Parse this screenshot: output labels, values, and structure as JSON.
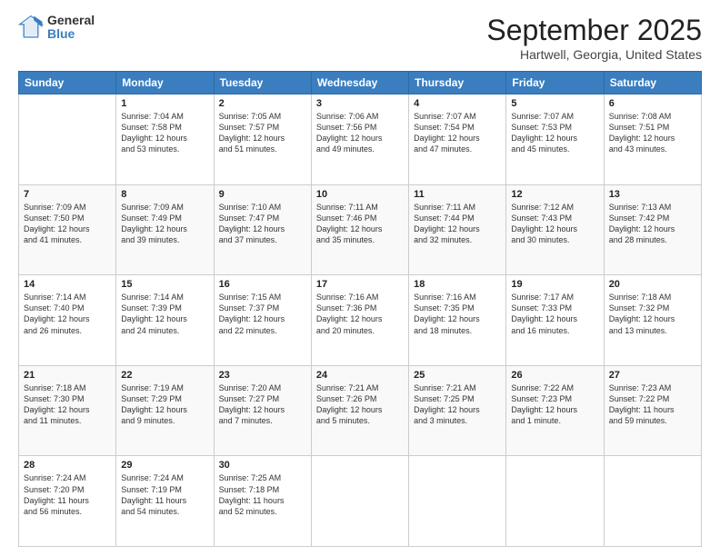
{
  "logo": {
    "general": "General",
    "blue": "Blue"
  },
  "title": {
    "month": "September 2025",
    "location": "Hartwell, Georgia, United States"
  },
  "header_days": [
    "Sunday",
    "Monday",
    "Tuesday",
    "Wednesday",
    "Thursday",
    "Friday",
    "Saturday"
  ],
  "weeks": [
    [
      {
        "day": "",
        "info": ""
      },
      {
        "day": "1",
        "info": "Sunrise: 7:04 AM\nSunset: 7:58 PM\nDaylight: 12 hours\nand 53 minutes."
      },
      {
        "day": "2",
        "info": "Sunrise: 7:05 AM\nSunset: 7:57 PM\nDaylight: 12 hours\nand 51 minutes."
      },
      {
        "day": "3",
        "info": "Sunrise: 7:06 AM\nSunset: 7:56 PM\nDaylight: 12 hours\nand 49 minutes."
      },
      {
        "day": "4",
        "info": "Sunrise: 7:07 AM\nSunset: 7:54 PM\nDaylight: 12 hours\nand 47 minutes."
      },
      {
        "day": "5",
        "info": "Sunrise: 7:07 AM\nSunset: 7:53 PM\nDaylight: 12 hours\nand 45 minutes."
      },
      {
        "day": "6",
        "info": "Sunrise: 7:08 AM\nSunset: 7:51 PM\nDaylight: 12 hours\nand 43 minutes."
      }
    ],
    [
      {
        "day": "7",
        "info": "Sunrise: 7:09 AM\nSunset: 7:50 PM\nDaylight: 12 hours\nand 41 minutes."
      },
      {
        "day": "8",
        "info": "Sunrise: 7:09 AM\nSunset: 7:49 PM\nDaylight: 12 hours\nand 39 minutes."
      },
      {
        "day": "9",
        "info": "Sunrise: 7:10 AM\nSunset: 7:47 PM\nDaylight: 12 hours\nand 37 minutes."
      },
      {
        "day": "10",
        "info": "Sunrise: 7:11 AM\nSunset: 7:46 PM\nDaylight: 12 hours\nand 35 minutes."
      },
      {
        "day": "11",
        "info": "Sunrise: 7:11 AM\nSunset: 7:44 PM\nDaylight: 12 hours\nand 32 minutes."
      },
      {
        "day": "12",
        "info": "Sunrise: 7:12 AM\nSunset: 7:43 PM\nDaylight: 12 hours\nand 30 minutes."
      },
      {
        "day": "13",
        "info": "Sunrise: 7:13 AM\nSunset: 7:42 PM\nDaylight: 12 hours\nand 28 minutes."
      }
    ],
    [
      {
        "day": "14",
        "info": "Sunrise: 7:14 AM\nSunset: 7:40 PM\nDaylight: 12 hours\nand 26 minutes."
      },
      {
        "day": "15",
        "info": "Sunrise: 7:14 AM\nSunset: 7:39 PM\nDaylight: 12 hours\nand 24 minutes."
      },
      {
        "day": "16",
        "info": "Sunrise: 7:15 AM\nSunset: 7:37 PM\nDaylight: 12 hours\nand 22 minutes."
      },
      {
        "day": "17",
        "info": "Sunrise: 7:16 AM\nSunset: 7:36 PM\nDaylight: 12 hours\nand 20 minutes."
      },
      {
        "day": "18",
        "info": "Sunrise: 7:16 AM\nSunset: 7:35 PM\nDaylight: 12 hours\nand 18 minutes."
      },
      {
        "day": "19",
        "info": "Sunrise: 7:17 AM\nSunset: 7:33 PM\nDaylight: 12 hours\nand 16 minutes."
      },
      {
        "day": "20",
        "info": "Sunrise: 7:18 AM\nSunset: 7:32 PM\nDaylight: 12 hours\nand 13 minutes."
      }
    ],
    [
      {
        "day": "21",
        "info": "Sunrise: 7:18 AM\nSunset: 7:30 PM\nDaylight: 12 hours\nand 11 minutes."
      },
      {
        "day": "22",
        "info": "Sunrise: 7:19 AM\nSunset: 7:29 PM\nDaylight: 12 hours\nand 9 minutes."
      },
      {
        "day": "23",
        "info": "Sunrise: 7:20 AM\nSunset: 7:27 PM\nDaylight: 12 hours\nand 7 minutes."
      },
      {
        "day": "24",
        "info": "Sunrise: 7:21 AM\nSunset: 7:26 PM\nDaylight: 12 hours\nand 5 minutes."
      },
      {
        "day": "25",
        "info": "Sunrise: 7:21 AM\nSunset: 7:25 PM\nDaylight: 12 hours\nand 3 minutes."
      },
      {
        "day": "26",
        "info": "Sunrise: 7:22 AM\nSunset: 7:23 PM\nDaylight: 12 hours\nand 1 minute."
      },
      {
        "day": "27",
        "info": "Sunrise: 7:23 AM\nSunset: 7:22 PM\nDaylight: 11 hours\nand 59 minutes."
      }
    ],
    [
      {
        "day": "28",
        "info": "Sunrise: 7:24 AM\nSunset: 7:20 PM\nDaylight: 11 hours\nand 56 minutes."
      },
      {
        "day": "29",
        "info": "Sunrise: 7:24 AM\nSunset: 7:19 PM\nDaylight: 11 hours\nand 54 minutes."
      },
      {
        "day": "30",
        "info": "Sunrise: 7:25 AM\nSunset: 7:18 PM\nDaylight: 11 hours\nand 52 minutes."
      },
      {
        "day": "",
        "info": ""
      },
      {
        "day": "",
        "info": ""
      },
      {
        "day": "",
        "info": ""
      },
      {
        "day": "",
        "info": ""
      }
    ]
  ]
}
